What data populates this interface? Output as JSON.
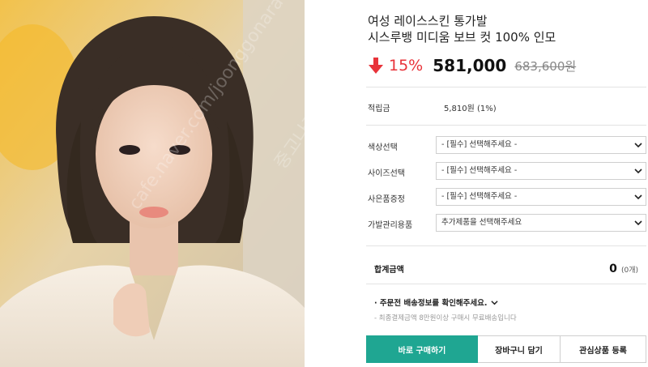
{
  "product": {
    "title_line1": "여성 레이스스킨 통가발",
    "title_line2": "시스루뱅 미디움 보브 컷 100% 인모",
    "discount": "15%",
    "price": "581,000",
    "original_price": "683,600원",
    "image_watermarks": [
      "cafe.naver.com/joonggonara",
      "중고나라"
    ]
  },
  "points": {
    "label": "적립금",
    "value": "5,810원 (1%)"
  },
  "options": [
    {
      "label": "색상선택",
      "value": "- [필수] 선택해주세요 -"
    },
    {
      "label": "사이즈선택",
      "value": "- [필수] 선택해주세요 -"
    },
    {
      "label": "사은품증정",
      "value": "- [필수] 선택해주세요 -"
    },
    {
      "label": "가발관리용품",
      "value": "추가제품을 선택해주세요"
    }
  ],
  "total": {
    "label": "합계금액",
    "amount": "0",
    "unit": "(0개)"
  },
  "shipping": {
    "note": "· 주문전 배송정보를 확인해주세요.",
    "sub": "- 최종결제금액 8만원이상 구매시 무료배송입니다"
  },
  "buttons": {
    "buy": "바로 구매하기",
    "cart": "장바구니 담기",
    "wish": "관심상품 등록"
  },
  "colors": {
    "discount_red": "#e8333a",
    "buy_teal": "#1fa692"
  },
  "icons": [
    "down-arrow-icon",
    "chevron-down-icon"
  ]
}
